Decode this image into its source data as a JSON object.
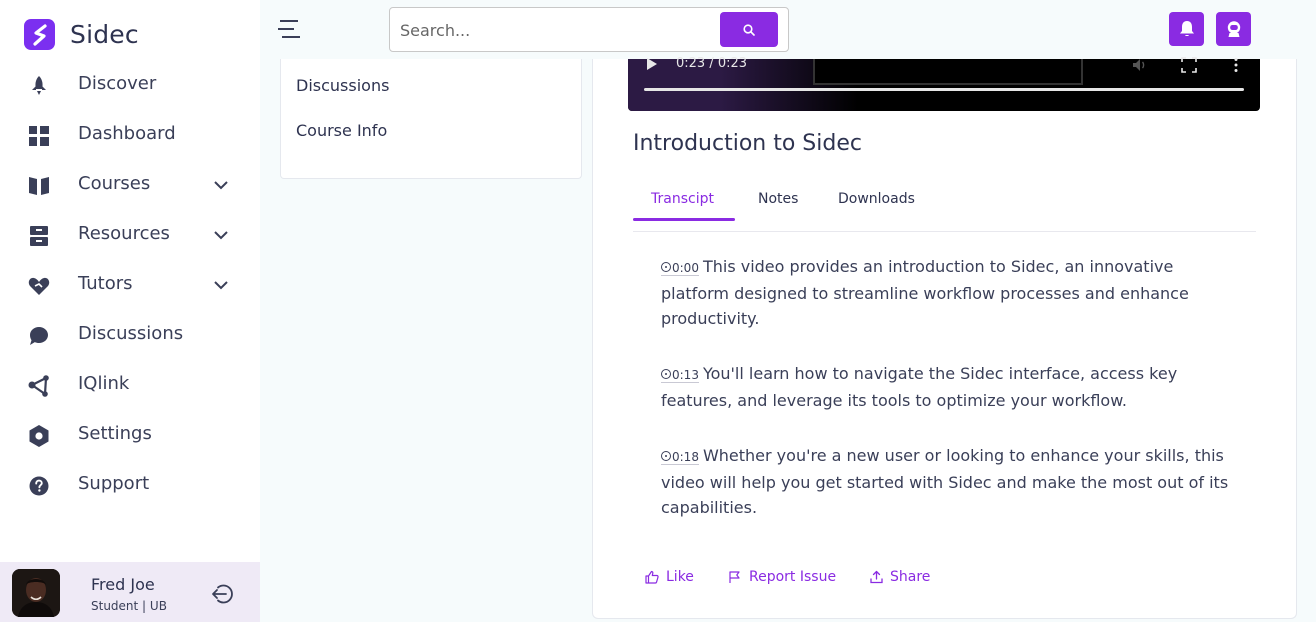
{
  "brand": {
    "name": "Sidec"
  },
  "sidebar": {
    "items": [
      {
        "label": "Discover",
        "icon": "rocket-icon",
        "has_chevron": false
      },
      {
        "label": "Dashboard",
        "icon": "grid-icon",
        "has_chevron": false
      },
      {
        "label": "Courses",
        "icon": "book-icon",
        "has_chevron": true
      },
      {
        "label": "Resources",
        "icon": "archive-icon",
        "has_chevron": true
      },
      {
        "label": "Tutors",
        "icon": "heart-hand-icon",
        "has_chevron": true
      },
      {
        "label": "Discussions",
        "icon": "chat-bubble-icon",
        "has_chevron": false
      },
      {
        "label": "IQlink",
        "icon": "share-nodes-icon",
        "has_chevron": false
      },
      {
        "label": "Settings",
        "icon": "gear-hexagon-icon",
        "has_chevron": false
      },
      {
        "label": "Support",
        "icon": "help-circle-icon",
        "has_chevron": false
      }
    ]
  },
  "user": {
    "name": "Fred Joe",
    "role": "Student | UB"
  },
  "search": {
    "placeholder": "Search..."
  },
  "course_menu": {
    "items": [
      "Discussions",
      "Course Info"
    ]
  },
  "video": {
    "time": "0:23 / 0:23"
  },
  "lesson": {
    "title": "Introduction to Sidec",
    "tabs": [
      "Transcipt",
      "Notes",
      "Downloads"
    ],
    "active_tab": "Transcipt",
    "transcript": [
      {
        "time": "0:00",
        "text": "This video provides an introduction to Sidec, an innovative platform designed to streamline workflow processes and enhance productivity."
      },
      {
        "time": "0:13",
        "text": "You'll learn how to navigate the Sidec interface, access key features, and leverage its tools to optimize your workflow."
      },
      {
        "time": "0:18",
        "text": "Whether you're a new user or looking to enhance your skills, this video will help you get started with Sidec and make the most out of its capabilities."
      }
    ],
    "actions": {
      "like": "Like",
      "report": "Report Issue",
      "share": "Share"
    }
  },
  "colors": {
    "accent": "#8a2be2",
    "text": "#3a3f58",
    "sidebar_bg": "#ffffff",
    "page_bg": "#f6fbfc",
    "user_card_bg": "#efeaf6"
  }
}
